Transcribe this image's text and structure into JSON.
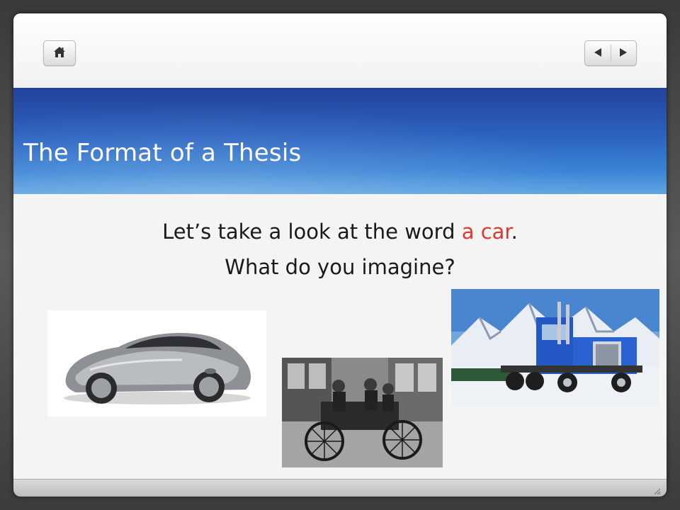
{
  "slide": {
    "title": "The Format of a Thesis",
    "body_line1_before": "Let’s take a look at the word ",
    "body_line1_accent": "a car",
    "body_line1_after": ".",
    "body_line2": "What do you imagine?"
  },
  "nav": {
    "home_icon": "home-icon",
    "prev_icon": "triangle-left-icon",
    "next_icon": "triangle-right-icon"
  },
  "colors": {
    "accent": "#e0392f",
    "banner_top": "#23439a",
    "banner_bottom": "#4a98df"
  },
  "images": [
    {
      "name": "sports-car-photo"
    },
    {
      "name": "antique-car-photo"
    },
    {
      "name": "semi-truck-photo"
    }
  ]
}
